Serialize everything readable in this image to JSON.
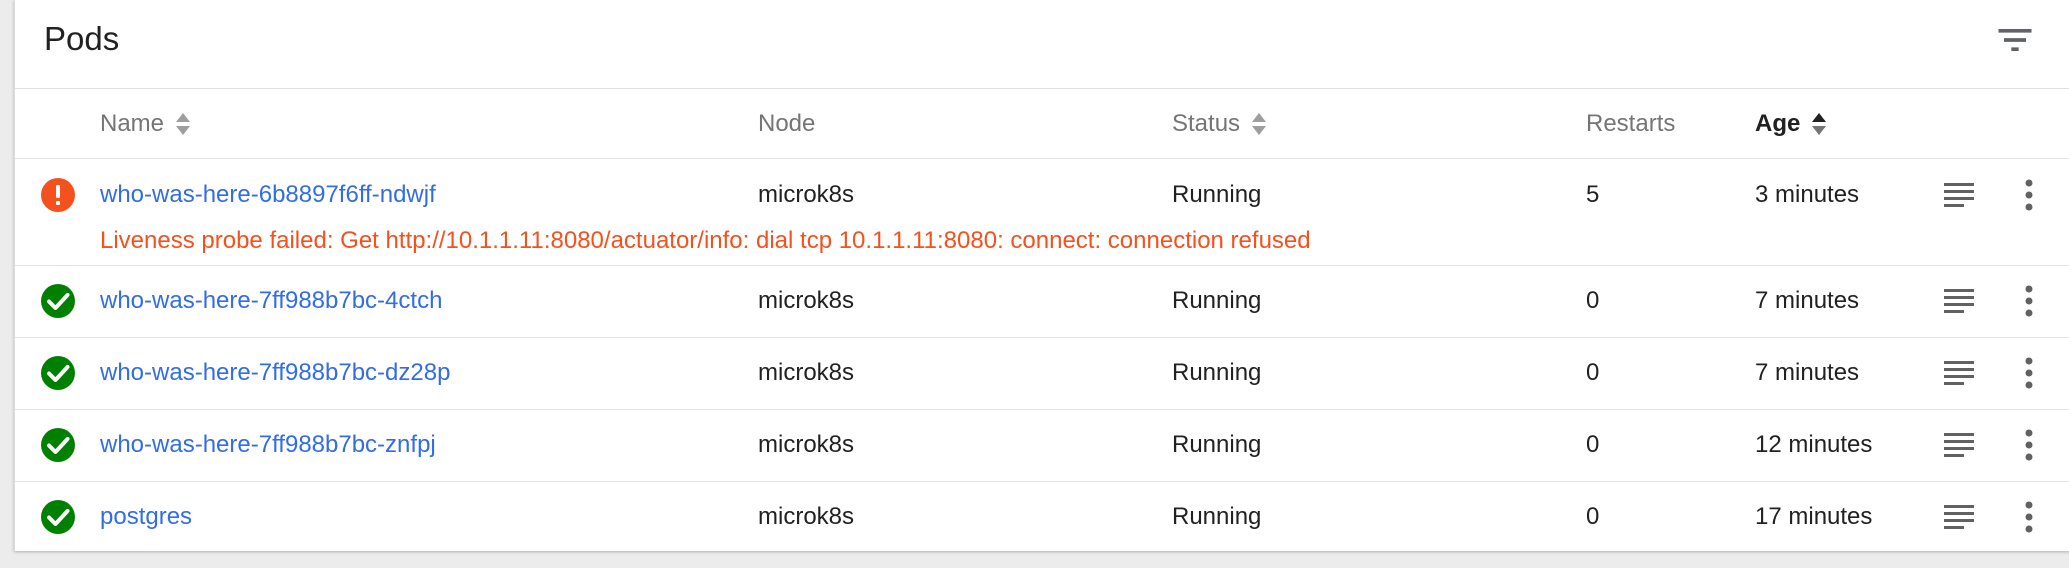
{
  "card": {
    "title": "Pods"
  },
  "icons": {
    "filter": "filter-list-icon",
    "sort": "sort-icon",
    "logs": "logs-icon",
    "more": "more-vert-icon",
    "ok": "check-circle-icon",
    "error": "error-circle-icon"
  },
  "colors": {
    "link": "#326de6",
    "error": "#f4511e",
    "success": "#008000"
  },
  "columns": {
    "name": "Name",
    "node": "Node",
    "status": "Status",
    "restarts": "Restarts",
    "age": "Age"
  },
  "rows": [
    {
      "name": "who-was-here-6b8897f6ff-ndwjf",
      "node": "microk8s",
      "status": "Running",
      "restarts": "5",
      "age": "3 minutes",
      "state": "error",
      "message": "Liveness probe failed: Get http://10.1.1.11:8080/actuator/info: dial tcp 10.1.1.11:8080: connect: connection refused"
    },
    {
      "name": "who-was-here-7ff988b7bc-4ctch",
      "node": "microk8s",
      "status": "Running",
      "restarts": "0",
      "age": "7 minutes",
      "state": "ok"
    },
    {
      "name": "who-was-here-7ff988b7bc-dz28p",
      "node": "microk8s",
      "status": "Running",
      "restarts": "0",
      "age": "7 minutes",
      "state": "ok"
    },
    {
      "name": "who-was-here-7ff988b7bc-znfpj",
      "node": "microk8s",
      "status": "Running",
      "restarts": "0",
      "age": "12 minutes",
      "state": "ok"
    },
    {
      "name": "postgres",
      "node": "microk8s",
      "status": "Running",
      "restarts": "0",
      "age": "17 minutes",
      "state": "ok"
    }
  ]
}
